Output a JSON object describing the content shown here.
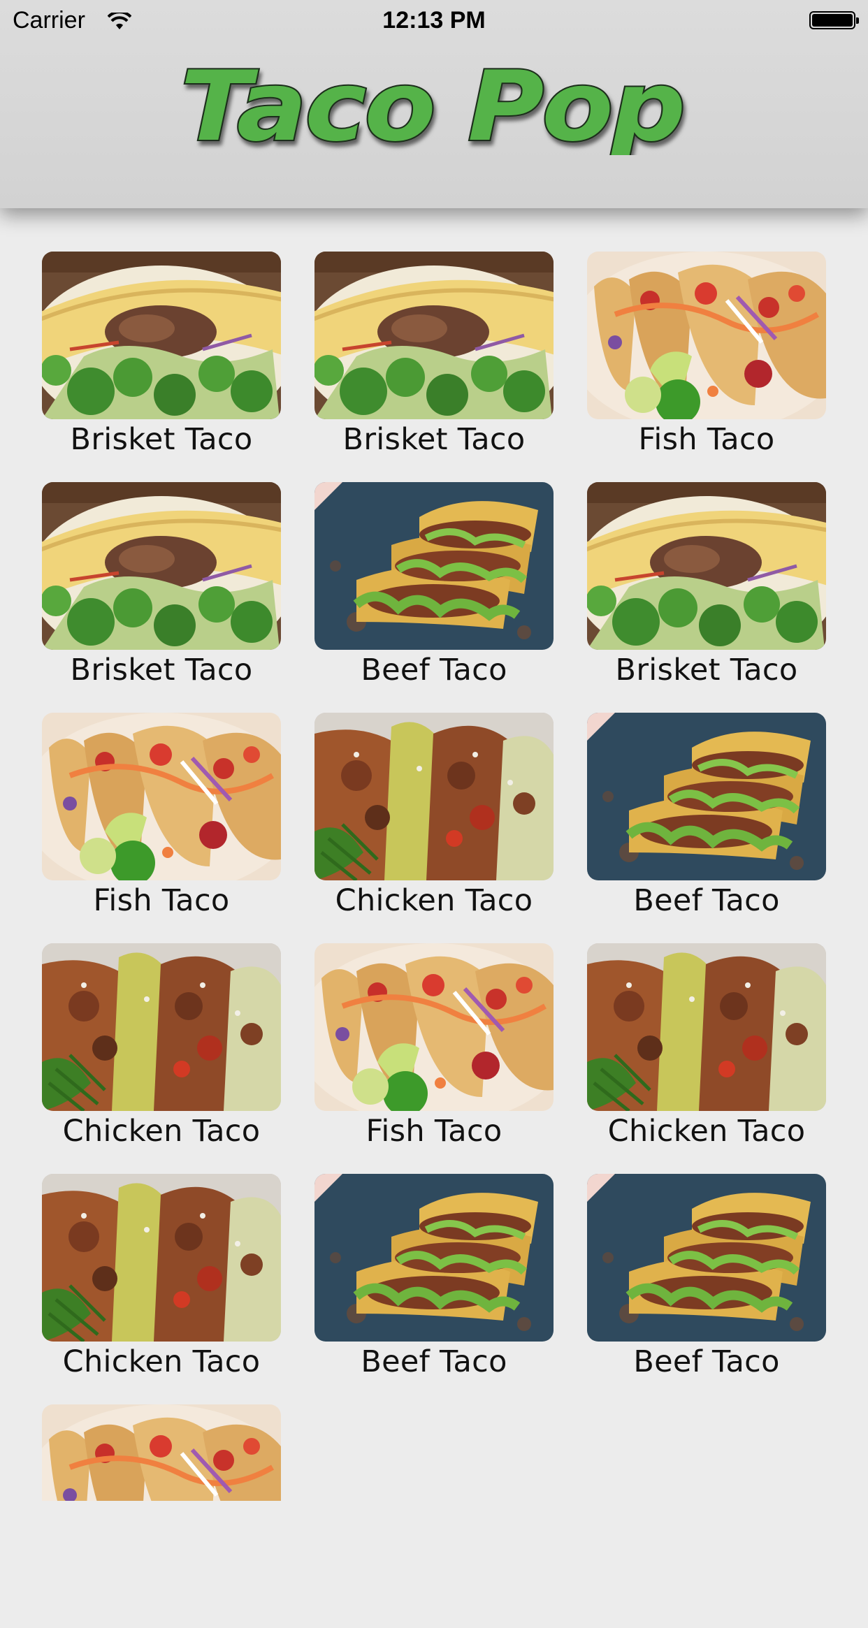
{
  "status_bar": {
    "carrier": "Carrier",
    "time": "12:13 PM"
  },
  "header": {
    "logo_text": "Taco Pop",
    "logo_color": "#55b348"
  },
  "menu": {
    "items": [
      {
        "name": "Brisket Taco",
        "photo": "brisket"
      },
      {
        "name": "Brisket Taco",
        "photo": "brisket"
      },
      {
        "name": "Fish Taco",
        "photo": "fish"
      },
      {
        "name": "Brisket Taco",
        "photo": "brisket"
      },
      {
        "name": "Beef Taco",
        "photo": "beef"
      },
      {
        "name": "Brisket Taco",
        "photo": "brisket"
      },
      {
        "name": "Fish Taco",
        "photo": "fish"
      },
      {
        "name": "Chicken Taco",
        "photo": "chicken"
      },
      {
        "name": "Beef Taco",
        "photo": "beef"
      },
      {
        "name": "Chicken Taco",
        "photo": "chicken"
      },
      {
        "name": "Fish Taco",
        "photo": "fish"
      },
      {
        "name": "Chicken Taco",
        "photo": "chicken"
      },
      {
        "name": "Chicken Taco",
        "photo": "chicken"
      },
      {
        "name": "Beef Taco",
        "photo": "beef"
      },
      {
        "name": "Beef Taco",
        "photo": "beef"
      },
      {
        "name": "",
        "photo": "fish"
      }
    ]
  }
}
